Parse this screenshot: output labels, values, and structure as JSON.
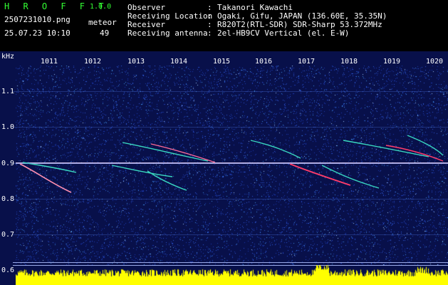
{
  "header": {
    "app_title": "H R O F F T",
    "version": "1.0.0",
    "filename": "2507231010.png",
    "timestamp": "25.07.23 10:10",
    "meteor_label": "meteor",
    "meteor_count": "49",
    "fields": [
      {
        "label": "Observer",
        "sep": ":",
        "value": "Takanori Kawachi"
      },
      {
        "label": "Receiving Location",
        "sep": ":",
        "value": "Ogaki, Gifu, JAPAN (136.60E, 35.35N)"
      },
      {
        "label": "Receiver",
        "sep": ":",
        "value": "R820T2(RTL-SDR) SDR-Sharp 53.372MHz"
      },
      {
        "label": "Receiving antenna",
        "sep": ":",
        "value": "2el-HB9CV Vertical (el. E-W)"
      }
    ]
  },
  "axis": {
    "unit": "kHz",
    "y_ticks": [
      "1.1",
      "1.0",
      "0.9",
      "0.8",
      "0.7",
      "0.6"
    ],
    "x_ticks": [
      "1011",
      "1012",
      "1013",
      "1014",
      "1015",
      "1016",
      "1017",
      "1018",
      "1019",
      "1020"
    ]
  },
  "colors": {
    "background": "#08104a",
    "carrier": "#e8d8ff",
    "trace": "#39d8c0",
    "trace_hot": "#ff3c6a",
    "level_bar": "#ffff00",
    "header_green": "#33ff33"
  }
}
